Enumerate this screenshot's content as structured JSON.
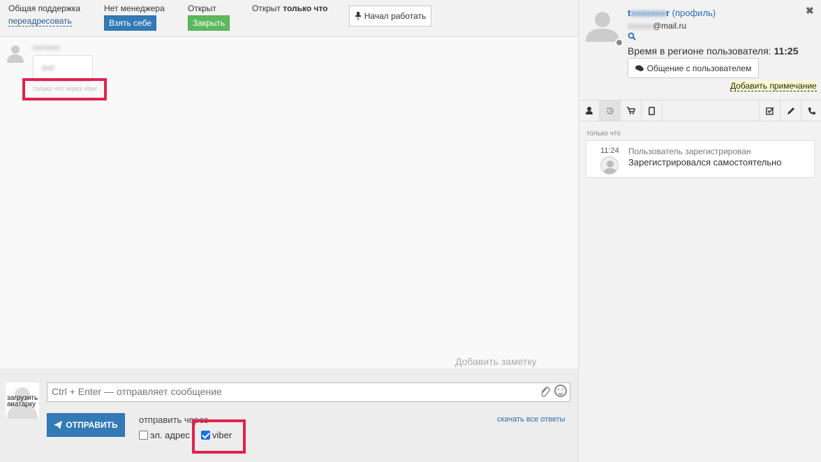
{
  "topbar": {
    "queue_label": "Общая поддержка",
    "redirect_link": "переадресовать",
    "manager_label": "Нет менеджера",
    "take_button": "Взять себе",
    "status_label": "Открыт",
    "close_button": "Закрыть",
    "opened_prefix": "Открыт",
    "opened_when": "только что",
    "start_work_button": "Начал работать"
  },
  "chat": {
    "message_sender": "username",
    "message_text": "text",
    "message_meta": "только что через viber",
    "add_note": "Добавить заметку"
  },
  "compose": {
    "upload_avatar_label": "загрузить аватарку",
    "input_placeholder": "Ctrl + Enter — отправляет сообщение",
    "send_button": "ОТПРАВИТЬ",
    "send_via_label": "отправить через",
    "channels": [
      {
        "label": "эл. адрес",
        "checked": false
      },
      {
        "label": "viber",
        "checked": true
      }
    ],
    "download_all": "скачать все ответы"
  },
  "user": {
    "name_start": "t",
    "name_blur": "xxxxxxx",
    "name_end": "r",
    "profile_link": "(профиль)",
    "email_blur": "xxxxxx",
    "email_domain": "@mail.ru",
    "region_time_label": "Время в регионе пользователя:",
    "region_time": "11:25",
    "chat_with_user_button": "Общение с пользователем",
    "add_remark": "Добавить примечание"
  },
  "tabs": [
    "user-icon",
    "history-icon",
    "cart-icon",
    "tablet-icon",
    "checkbox-icon",
    "pencil-icon",
    "phone-icon"
  ],
  "history": {
    "time_label": "только что",
    "entries": [
      {
        "time": "11:24",
        "event": "Пользователь зарегистрирован",
        "description": "Зарегистрировался самостоятельно"
      }
    ]
  },
  "colors": {
    "primary": "#337ab7",
    "success": "#5cb85c",
    "highlight": "#e0234e",
    "link": "#2a6fb0"
  }
}
